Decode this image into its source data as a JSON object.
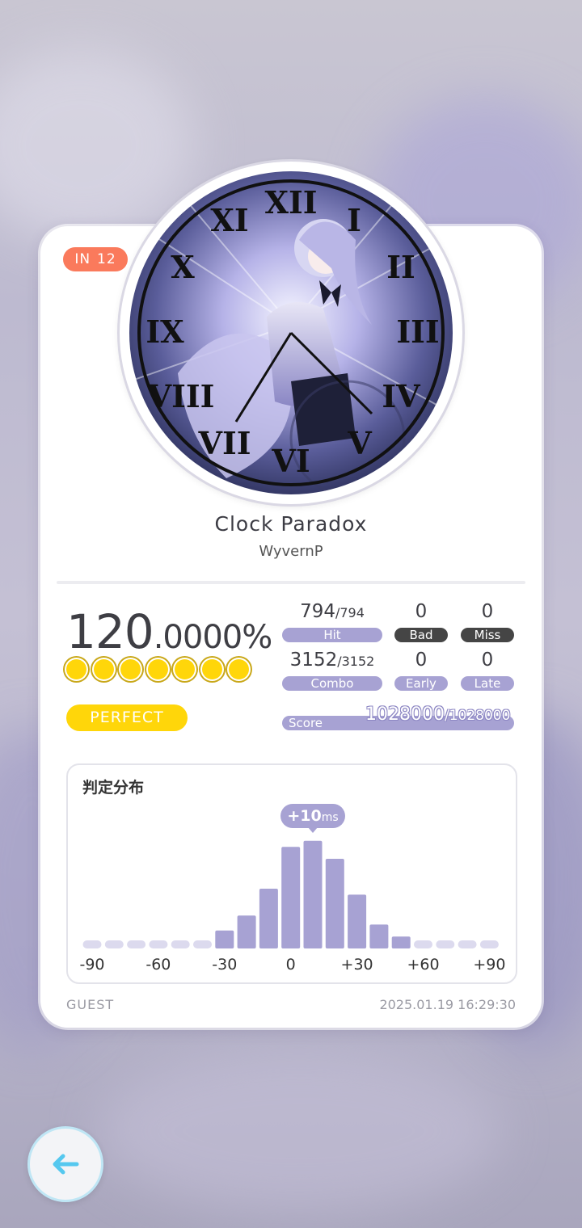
{
  "level": {
    "mode": "IN",
    "number": "12"
  },
  "song": {
    "title": "Clock Paradox",
    "artist": "WyvernP"
  },
  "accuracy": {
    "integer": "120",
    "fraction": ".0000%"
  },
  "perfect_badge": "PERFECT",
  "stats": {
    "hit": {
      "value": "794",
      "total": "/794",
      "label": "Hit"
    },
    "bad": {
      "value": "0",
      "label": "Bad"
    },
    "miss": {
      "value": "0",
      "label": "Miss"
    },
    "combo": {
      "value": "3152",
      "total": "/3152",
      "label": "Combo"
    },
    "early": {
      "value": "0",
      "label": "Early"
    },
    "late": {
      "value": "0",
      "label": "Late"
    },
    "score": {
      "label": "Score",
      "value": "1028000",
      "total": "/1028000"
    }
  },
  "distribution": {
    "title": "判定分布",
    "peak_value": "+10",
    "peak_unit": "ms",
    "tick_labels": [
      "-90",
      "-60",
      "-30",
      "0",
      "+30",
      "+60",
      "+90"
    ]
  },
  "chart_data": {
    "type": "bar",
    "categories": [
      "-90",
      "-80",
      "-70",
      "-60",
      "-50",
      "-40",
      "-30",
      "-20",
      "-10",
      "0",
      "+10",
      "+20",
      "+30",
      "+40",
      "+50",
      "+60",
      "+70",
      "+80",
      "+90"
    ],
    "values": [
      1,
      1,
      1,
      1,
      1,
      1,
      3,
      5.5,
      10,
      17,
      18,
      15,
      9,
      4,
      2,
      1,
      1,
      1,
      1
    ],
    "xlabel": "",
    "ylabel": ""
  },
  "footer": {
    "player": "GUEST",
    "datetime": "2025.01.19 16:29:30"
  },
  "colors": {
    "accent": "#a7a2d3",
    "level": "#fa7a5c",
    "perfect": "#ffd60a",
    "back_arrow": "#55c8ef"
  },
  "icons": {
    "back": "arrow-left-icon",
    "jacket": "clock-art"
  }
}
